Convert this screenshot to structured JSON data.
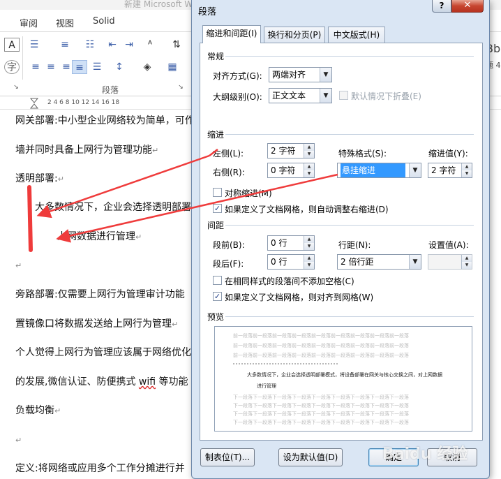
{
  "word": {
    "window_title": "新建 Microsoft W",
    "tabs": [
      "审阅",
      "视图",
      "Solid"
    ],
    "ribbon_group": "段落",
    "ruler_numbers": "2   4   6   8   10   12   14   16   18",
    "right_edge_text": "Bb",
    "right_edge_text2": "题 4",
    "lines": [
      "网关部署:中小型企业网络较为简单，可作",
      "墙并同时具备上网行为管理功能",
      "透明部署:",
      "大多数情况下，企业会选择透明部署",
      "上网数据进行管理",
      "",
      "旁路部署:仅需要上网行为管理审计功能",
      "置镜像口将数据发送给上网行为管理",
      "个人觉得上网行为管理应该属于网络优化",
      "的发展,微信认证、防便携式 ",
      "wifi",
      " 等功能",
      "负载均衡",
      "",
      "定义:将网络或应用多个工作分摊进行并"
    ],
    "para_mark": "↵"
  },
  "dialog": {
    "title": "段落",
    "help": "?",
    "close": "✕",
    "tabs": [
      "缩进和间距(I)",
      "换行和分页(P)",
      "中文版式(H)"
    ],
    "general": {
      "header": "常规",
      "align_label": "对齐方式(G):",
      "align_value": "两端对齐",
      "outline_label": "大纲级别(O):",
      "outline_value": "正文文本",
      "collapse_label": "默认情况下折叠(E)"
    },
    "indent": {
      "header": "缩进",
      "left_label": "左侧(L):",
      "left_value": "2 字符",
      "right_label": "右侧(R):",
      "right_value": "0 字符",
      "special_label": "特殊格式(S):",
      "special_value": "悬挂缩进",
      "by_label": "缩进值(Y):",
      "by_value": "2 字符",
      "mirror_label": "对称缩进(M)",
      "auto_adjust_label": "如果定义了文档网格，则自动调整右缩进(D)"
    },
    "spacing": {
      "header": "间距",
      "before_label": "段前(B):",
      "before_value": "0 行",
      "after_label": "段后(F):",
      "after_value": "0 行",
      "line_label": "行距(N):",
      "line_value": "2 倍行距",
      "at_label": "设置值(A):",
      "at_value": "",
      "no_space_label": "在相同样式的段落间不添加空格(C)",
      "snap_grid_label": "如果定义了文档网格，则对齐到网格(W)"
    },
    "preview": {
      "header": "预览",
      "filler": "前一段落前一段落前一段落前一段落前一段落前一段落前一段落前一段落前一段落",
      "sample1": "大多数情况下，企业会选择透明部署模式，将设备部署在网关与核心交换之间，对上网数据",
      "sample2": "进行管理",
      "after_filler": "下一段落下一段落下一段落下一段落下一段落下一段落下一段落下一段落下一段落"
    },
    "buttons": {
      "tabs": "制表位(T)...",
      "set_default": "设为默认值(D)",
      "ok": "确定",
      "cancel": "取消"
    },
    "checks": {
      "collapse": false,
      "mirror": false,
      "auto_adjust": true,
      "no_space": false,
      "snap_grid": true
    }
  },
  "watermark": "Baidu 经验",
  "colors": {
    "arrow": "#ef3b3b",
    "dialog_bg": "#dae6f4",
    "highlight": "#3399ff"
  }
}
